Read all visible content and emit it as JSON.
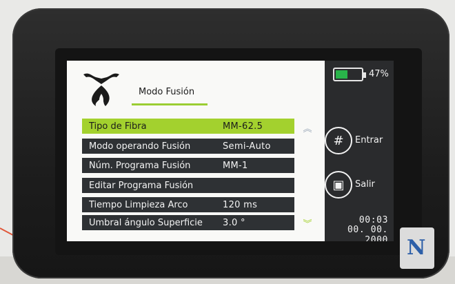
{
  "header": {
    "title": "Modo Fusión"
  },
  "menu": [
    {
      "label": "Tipo de Fibra",
      "value": "MM-62.5",
      "selected": true
    },
    {
      "label": "Modo operando Fusión",
      "value": "Semi-Auto",
      "selected": false
    },
    {
      "label": "Núm. Programa Fusión",
      "value": "MM-1",
      "selected": false
    },
    {
      "label": "Editar Programa Fusión",
      "value": "",
      "selected": false
    },
    {
      "label": "Tiempo Limpieza Arco",
      "value": "120  ms",
      "selected": false
    },
    {
      "label": "Umbral ángulo Superficie",
      "value": "3.0  °",
      "selected": false
    }
  ],
  "scroll": {
    "up_icon": "double-chevron-up-icon",
    "down_icon": "double-chevron-down-icon"
  },
  "side": {
    "battery": {
      "percent_text": "47%",
      "level": 0.47,
      "color": "#29b34a"
    },
    "enter_label": "Entrar",
    "exit_label": "Salir",
    "time": "00:03",
    "date": "00. 00. 2000"
  },
  "colors": {
    "selected": "#a3d12e",
    "row": "#2e3134",
    "accent_line": "#9acd32"
  }
}
